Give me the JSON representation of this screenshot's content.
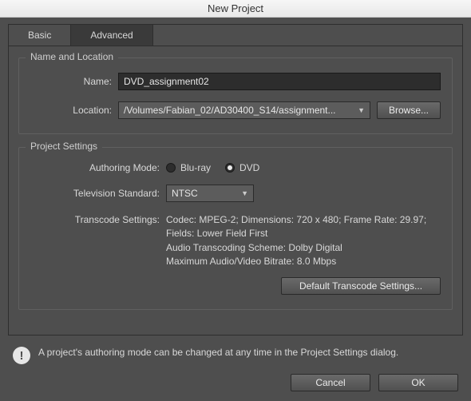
{
  "title": "New Project",
  "tabs": {
    "basic": "Basic",
    "advanced": "Advanced",
    "active": "basic"
  },
  "nameLocation": {
    "legend": "Name and Location",
    "nameLabel": "Name:",
    "nameValue": "DVD_assignment02",
    "locationLabel": "Location:",
    "locationValue": "/Volumes/Fabian_02/AD30400_S14/assignment...",
    "browse": "Browse..."
  },
  "projectSettings": {
    "legend": "Project Settings",
    "authoringLabel": "Authoring Mode:",
    "bluray": "Blu-ray",
    "dvd": "DVD",
    "authoringSelected": "dvd",
    "tvLabel": "Television Standard:",
    "tvValue": "NTSC",
    "transcodeLabel": "Transcode Settings:",
    "transcodeLines": {
      "l1": "Codec: MPEG-2; Dimensions: 720 x 480; Frame Rate: 29.97;",
      "l2": "Fields: Lower Field First",
      "l3": "Audio Transcoding Scheme: Dolby Digital",
      "l4": "Maximum Audio/Video Bitrate: 8.0 Mbps"
    },
    "defaultBtn": "Default Transcode Settings..."
  },
  "notice": "A project's authoring mode can be changed at any time in the Project Settings dialog.",
  "footer": {
    "cancel": "Cancel",
    "ok": "OK"
  }
}
